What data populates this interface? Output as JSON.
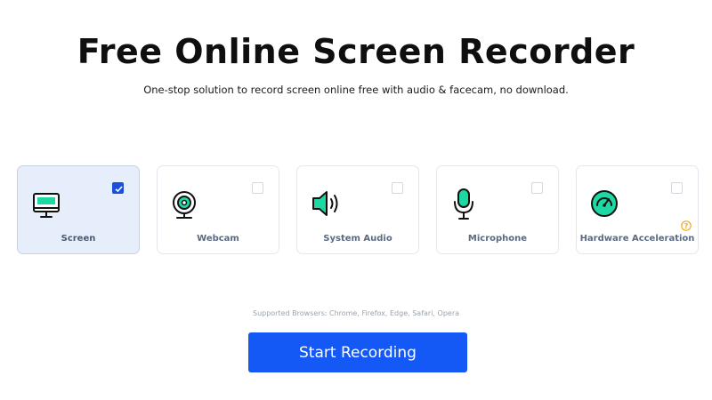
{
  "header": {
    "title": "Free Online Screen Recorder",
    "subtitle": "One-stop solution to record screen online free with audio & facecam, no download."
  },
  "options": [
    {
      "label": "Screen",
      "icon": "monitor-icon",
      "checked": true
    },
    {
      "label": "Webcam",
      "icon": "webcam-icon",
      "checked": false
    },
    {
      "label": "System Audio",
      "icon": "speaker-icon",
      "checked": false
    },
    {
      "label": "Microphone",
      "icon": "microphone-icon",
      "checked": false
    },
    {
      "label": "Hardware Acceleration",
      "icon": "speedometer-icon",
      "checked": false,
      "help_icon": "question-icon"
    }
  ],
  "footer": {
    "supported_browsers": "Supported Browsers: Chrome, Firefox, Edge, Safari, Opera",
    "start_button": "Start Recording"
  },
  "colors": {
    "accent": "#1458f5",
    "icon_green": "#1ed8a4",
    "selected_card_bg": "#e6eefc",
    "help_orange": "#f5a623"
  }
}
